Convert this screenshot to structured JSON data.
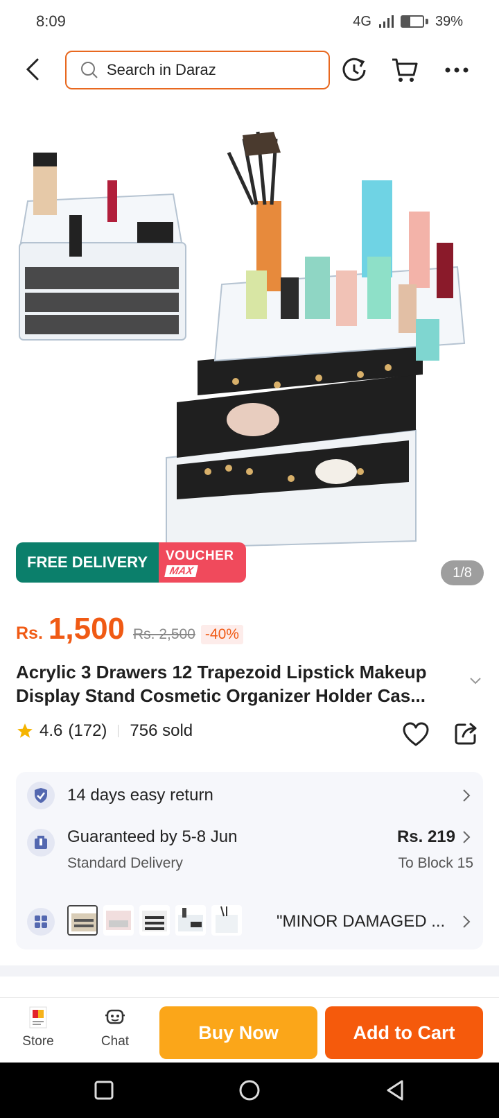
{
  "status": {
    "time": "8:09",
    "network": "4G",
    "battery": "39%",
    "battery_level": 0.39
  },
  "search": {
    "placeholder": "Search in Daraz"
  },
  "icons": {
    "back": "chevron-left-icon",
    "search": "search-icon",
    "history": "history-icon",
    "cart": "cart-icon",
    "more": "more-dots-icon"
  },
  "gallery": {
    "page_indicator": "1/8"
  },
  "badges": {
    "free_delivery": "FREE DELIVERY",
    "voucher_top": "VOUCHER",
    "voucher_bottom": "MAX"
  },
  "price": {
    "currency": "Rs.",
    "value": "1,500",
    "old": "Rs. 2,500",
    "discount": "-40%"
  },
  "product": {
    "title_line1": "Acrylic 3 Drawers 12 Trapezoid Lipstick Makeup",
    "title_line2": "Display Stand Cosmetic Organizer Holder Cas..."
  },
  "rating": {
    "score": "4.6",
    "count": "(172)",
    "sold": "756 sold"
  },
  "info": {
    "return": "14 days easy return",
    "delivery": "Guaranteed by 5-8 Jun",
    "delivery_type": "Standard Delivery",
    "delivery_price": "Rs. 219",
    "delivery_location": "To Block 15",
    "variant": "\"MINOR DAMAGED ..."
  },
  "bottom": {
    "store": "Store",
    "chat": "Chat",
    "buy_now": "Buy Now",
    "add_to_cart": "Add to Cart"
  },
  "colors": {
    "accent": "#f05a14",
    "buy": "#fba619",
    "cart": "#f55a0c",
    "free": "#0b7f6b",
    "voucher": "#f04a5c"
  }
}
